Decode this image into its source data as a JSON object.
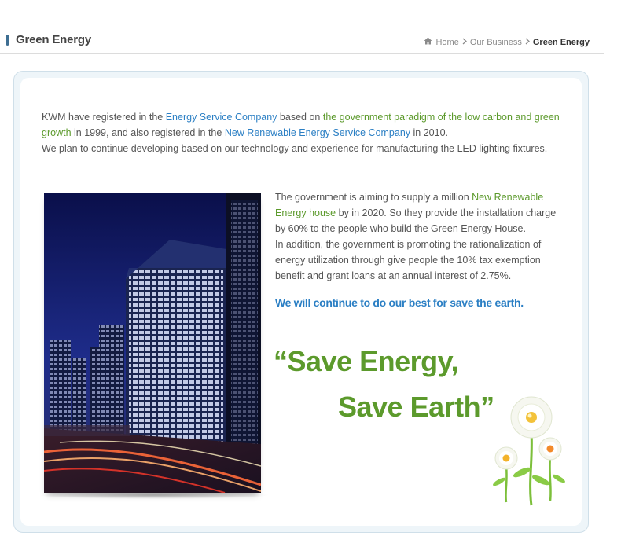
{
  "header": {
    "title": "Green Energy",
    "breadcrumb": [
      {
        "label": "Home"
      },
      {
        "label": "Our Business"
      },
      {
        "label": "Green Energy"
      }
    ]
  },
  "intro": {
    "p1_a": "KWM have registered in the ",
    "p1_b": "Energy Service Company",
    "p1_c": " based on ",
    "p1_d": "the government paradigm of the low carbon and green growth",
    "p1_e": " in 1999, and also registered in the ",
    "p1_f": "New Renewable Energy Service Company",
    "p1_g": " in 2010.",
    "p2": "We plan to continue developing based on our technology and experience for manufacturing the LED lighting fixtures."
  },
  "body": {
    "a": "The government is aiming to supply a million ",
    "b": "New Renewable Energy house",
    "c": " by in 2020. So they provide the installation charge by 60% to the people who build the Green Energy House.",
    "d": "In addition, the government is promoting the rationalization of energy utilization through give people the 10% tax exemption benefit and grant loans at an annual interest of 2.75%."
  },
  "commitment": "We will continue to do our best for save the earth.",
  "slogan": {
    "line1": "“Save Energy,",
    "line2": "Save Earth”"
  },
  "colors": {
    "accent_blue": "#2b7fc4",
    "accent_green": "#5c9a2c",
    "title_marker": "#3e6e92"
  },
  "icons": [
    "home-icon",
    "chevron-right-icon",
    "building-photo",
    "flower-illustration"
  ]
}
